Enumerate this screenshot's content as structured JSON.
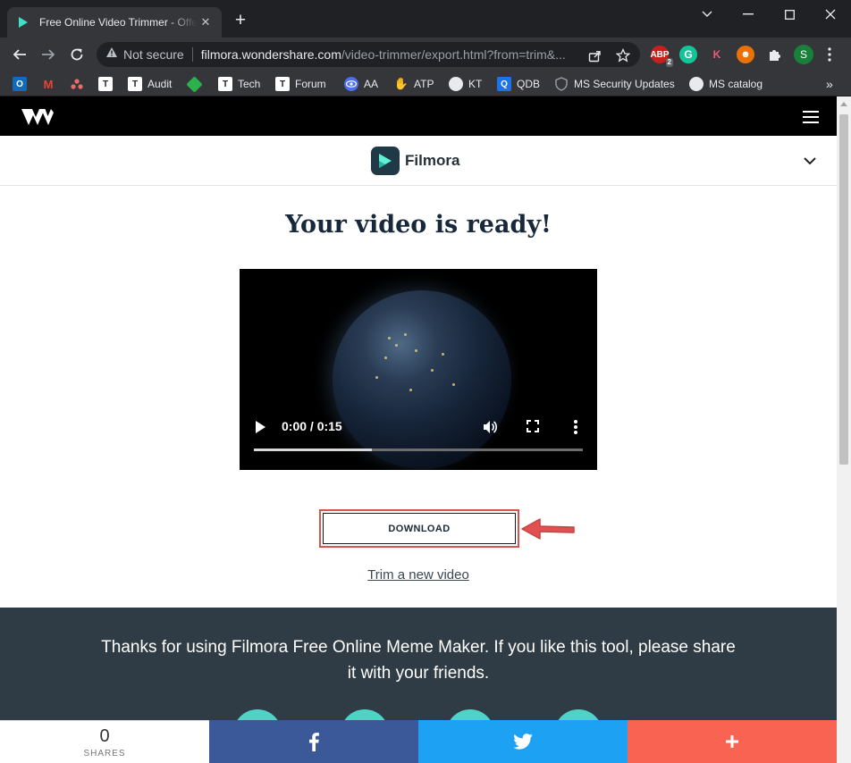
{
  "browser": {
    "tab_title": "Free Online Video Trimmer - Offer",
    "security_label": "Not secure",
    "url_host": "filmora.wondershare.com",
    "url_path": "/video-trimmer/export.html?from=trim&...",
    "profile_initial": "S",
    "ext_abp_badge": "2",
    "bookmarks": [
      {
        "label": "",
        "icon": "outlook-icon",
        "color": "#0f6cbd",
        "glyph": "O"
      },
      {
        "label": "",
        "icon": "gmail-icon",
        "color": "#ea4335",
        "glyph": "M"
      },
      {
        "label": "",
        "icon": "asana-icon",
        "color": "#f06a6a",
        "glyph": "●"
      },
      {
        "label": "",
        "icon": "bookmark-t-icon",
        "color": "#ffffff",
        "glyph": "T"
      },
      {
        "label": "Audit",
        "icon": "bookmark-t-icon",
        "color": "#ffffff",
        "glyph": "T"
      },
      {
        "label": "",
        "icon": "feedly-icon",
        "color": "#2bb24c",
        "glyph": "f"
      },
      {
        "label": "Tech",
        "icon": "bookmark-t-icon",
        "color": "#ffffff",
        "glyph": "T"
      },
      {
        "label": "Forum",
        "icon": "bookmark-t-icon",
        "color": "#ffffff",
        "glyph": "T"
      },
      {
        "label": "AA",
        "icon": "eye-icon",
        "color": "#4c6ef5",
        "glyph": "◉"
      },
      {
        "label": "ATP",
        "icon": "atp-icon",
        "color": "#4b3fc7",
        "glyph": "✋"
      },
      {
        "label": "KT",
        "icon": "globe-icon",
        "color": "#e8eaed",
        "glyph": "●"
      },
      {
        "label": "QDB",
        "icon": "qdb-icon",
        "color": "#1a73e8",
        "glyph": "Q"
      },
      {
        "label": "MS Security Updates",
        "icon": "shield-icon",
        "color": "#9aa0a6",
        "glyph": "⛨"
      },
      {
        "label": "MS catalog",
        "icon": "globe-icon",
        "color": "#e8eaed",
        "glyph": "●"
      }
    ],
    "more_bookmarks": "»"
  },
  "page": {
    "brand_name": "Filmora",
    "title": "Your video is ready!",
    "video": {
      "time": "0:00 / 0:15",
      "progress": 0.36
    },
    "download_label": "DOWNLOAD",
    "trim_link": "Trim a new video",
    "footer_text": "Thanks for using Filmora Free Online Meme Maker. If you like this tool, please share it with your friends.",
    "shares_count": "0",
    "shares_label": "SHARES"
  },
  "colors": {
    "accent_red": "#d9534f",
    "facebook": "#3b5998",
    "twitter": "#1da1f2",
    "more": "#f96452",
    "footer_bg": "#2f3c45"
  }
}
